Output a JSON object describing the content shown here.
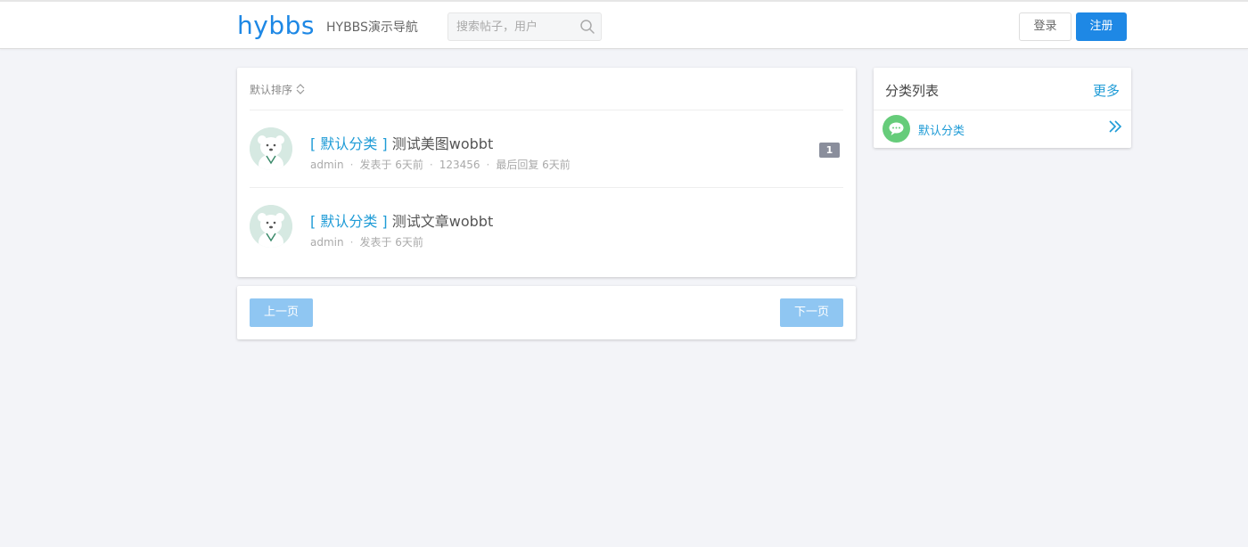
{
  "header": {
    "logo": "hybbs",
    "nav_link": "HYBBS演示导航",
    "search_placeholder": "搜索帖子，用户",
    "login_label": "登录",
    "register_label": "注册"
  },
  "main": {
    "sort_label": "默认排序",
    "threads": [
      {
        "category": "[ 默认分类 ]",
        "title": "测试美图wobbt",
        "author": "admin",
        "posted": "发表于 6天前",
        "last_user": "123456",
        "last_reply": "最后回复 6天前",
        "replies": "1"
      },
      {
        "category": "[ 默认分类 ]",
        "title": "测试文章wobbt",
        "author": "admin",
        "posted": "发表于 6天前"
      }
    ],
    "pager": {
      "prev_label": "上一页",
      "next_label": "下一页"
    }
  },
  "sidebar": {
    "title": "分类列表",
    "more_label": "更多",
    "items": [
      {
        "label": "默认分类"
      }
    ]
  },
  "colors": {
    "accent": "#1e88e5",
    "link": "#1e9bd6",
    "category_icon": "#66cc7a",
    "pager_button": "#8fc6f2"
  },
  "icons": [
    "search-icon",
    "sort-icon",
    "avatar",
    "chat-bubble-icon",
    "double-chevron-right-icon"
  ]
}
